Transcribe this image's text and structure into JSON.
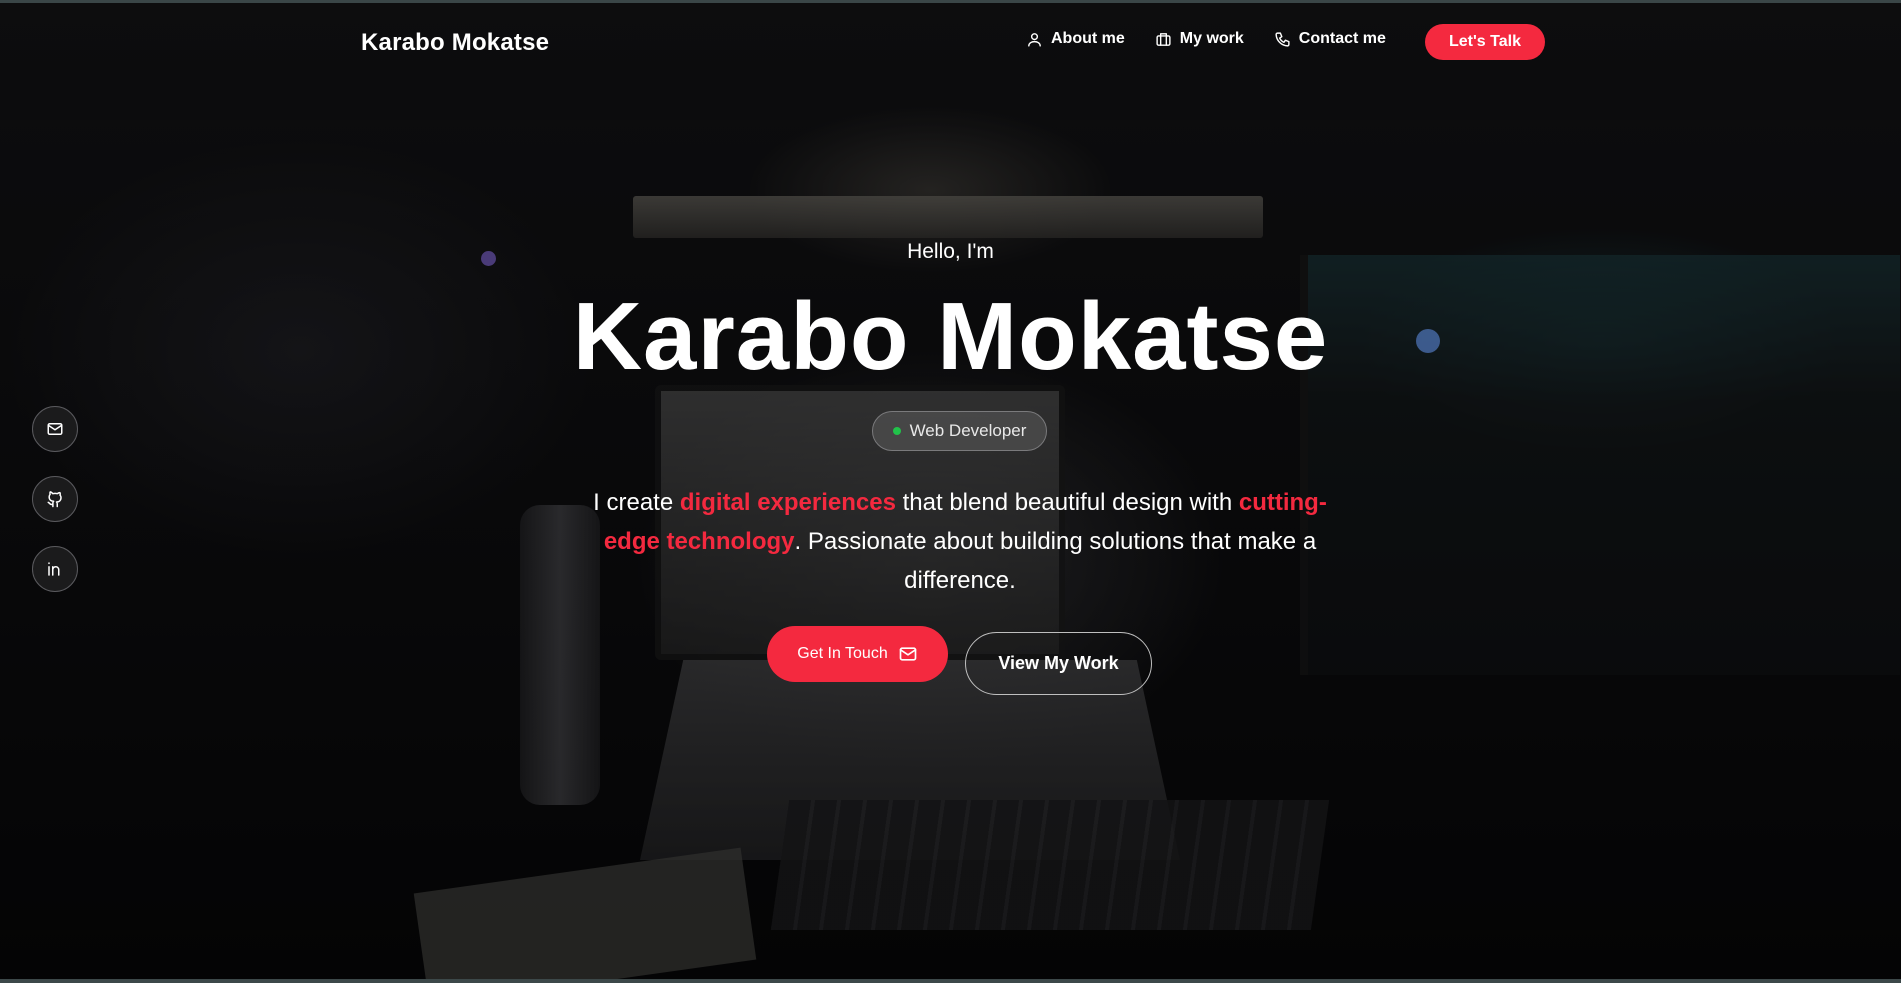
{
  "brand": "Karabo Mokatse",
  "nav": {
    "items": [
      {
        "label": "About me",
        "icon": "user-icon"
      },
      {
        "label": "My work",
        "icon": "briefcase-icon"
      },
      {
        "label": "Contact me",
        "icon": "phone-icon"
      }
    ],
    "cta": "Let's Talk"
  },
  "social": [
    {
      "icon": "mail-icon"
    },
    {
      "icon": "github-icon"
    },
    {
      "icon": "linkedin-icon"
    }
  ],
  "hero": {
    "greeting": "Hello, I'm",
    "name": "Karabo Mokatse",
    "role": "Web Developer",
    "tagline": {
      "part1": "I create ",
      "highlight1": "digital experiences",
      "part2": " that blend beautiful design with ",
      "highlight2": "cutting-edge technology",
      "part3": ". Passionate about building solutions that make a difference."
    },
    "primary_button": "Get In Touch",
    "secondary_button": "View My Work"
  },
  "colors": {
    "accent": "#f4293f",
    "status": "#21c24a"
  }
}
